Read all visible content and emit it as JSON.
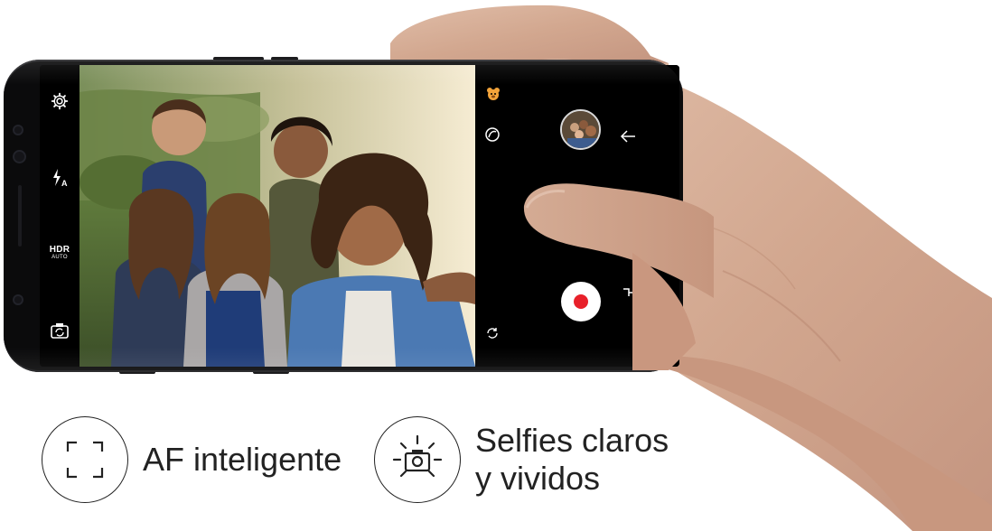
{
  "colors": {
    "record_button": "#e8202a",
    "phone_body": "#0b0b0c",
    "feature_text": "#222222",
    "background": "#ffffff",
    "skin": "#d7b09a"
  },
  "camera_ui": {
    "left_controls": [
      {
        "name": "settings",
        "icon": "gear-icon"
      },
      {
        "name": "flash",
        "icon": "flash-auto-icon"
      },
      {
        "name": "hdr",
        "icon": "hdr-auto-icon",
        "label": "HDR",
        "sublabel": "AUTO"
      },
      {
        "name": "switch-camera",
        "icon": "switch-camera-icon"
      }
    ],
    "right_controls": [
      {
        "name": "stickers",
        "icon": "bear-sticker-icon"
      },
      {
        "name": "filters",
        "icon": "filter-icon"
      },
      {
        "name": "gallery-thumbnail",
        "icon": "photo-thumbnail"
      },
      {
        "name": "back",
        "icon": "back-arrow-icon"
      },
      {
        "name": "capture-mode",
        "icon": "swap-mode-icon"
      },
      {
        "name": "record",
        "icon": "record-dot-icon"
      },
      {
        "name": "rotate",
        "icon": "rotate-icon"
      }
    ]
  },
  "features": [
    {
      "icon": "autofocus-frame-icon",
      "label": "AF inteligente"
    },
    {
      "icon": "bright-camera-icon",
      "line1": "Selfies claros",
      "line2": "y vividos"
    }
  ]
}
